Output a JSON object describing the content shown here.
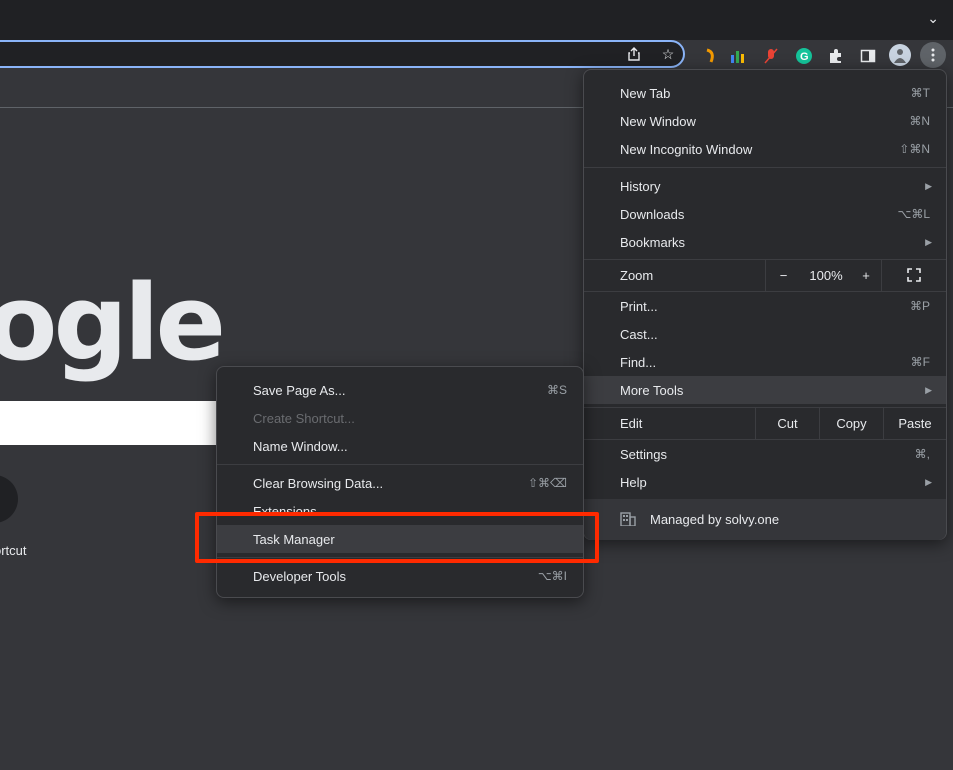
{
  "toolbar": {
    "icons": [
      "share-icon",
      "star-icon",
      "ext-orange-icon",
      "ext-chart-icon",
      "ext-mic-icon",
      "grammarly-icon",
      "puzzle-icon",
      "sidepanel-icon",
      "avatar",
      "kebab-menu-icon"
    ]
  },
  "page": {
    "logo_text": "ogle",
    "shortcut_label": "ortcut"
  },
  "main_menu": {
    "new_tab": {
      "label": "New Tab",
      "shortcut": "⌘T"
    },
    "new_window": {
      "label": "New Window",
      "shortcut": "⌘N"
    },
    "new_incognito": {
      "label": "New Incognito Window",
      "shortcut": "⇧⌘N"
    },
    "history": {
      "label": "History"
    },
    "downloads": {
      "label": "Downloads",
      "shortcut": "⌥⌘L"
    },
    "bookmarks": {
      "label": "Bookmarks"
    },
    "zoom": {
      "label": "Zoom",
      "minus": "−",
      "value": "100%",
      "plus": "+"
    },
    "print": {
      "label": "Print...",
      "shortcut": "⌘P"
    },
    "cast": {
      "label": "Cast..."
    },
    "find": {
      "label": "Find...",
      "shortcut": "⌘F"
    },
    "more_tools": {
      "label": "More Tools"
    },
    "edit": {
      "label": "Edit",
      "cut": "Cut",
      "copy": "Copy",
      "paste": "Paste"
    },
    "settings": {
      "label": "Settings",
      "shortcut": "⌘,"
    },
    "help": {
      "label": "Help"
    },
    "managed": {
      "label": "Managed by solvy.one"
    }
  },
  "sub_menu": {
    "save_page": {
      "label": "Save Page As...",
      "shortcut": "⌘S"
    },
    "create_shortcut": {
      "label": "Create Shortcut..."
    },
    "name_window": {
      "label": "Name Window..."
    },
    "clear_data": {
      "label": "Clear Browsing Data...",
      "shortcut": "⇧⌘⌫"
    },
    "extensions": {
      "label": "Extensions"
    },
    "task_manager": {
      "label": "Task Manager"
    },
    "developer_tools": {
      "label": "Developer Tools",
      "shortcut": "⌥⌘I"
    }
  },
  "colors": {
    "highlight": "#ff2a00",
    "accent": "#8ab4f8"
  }
}
